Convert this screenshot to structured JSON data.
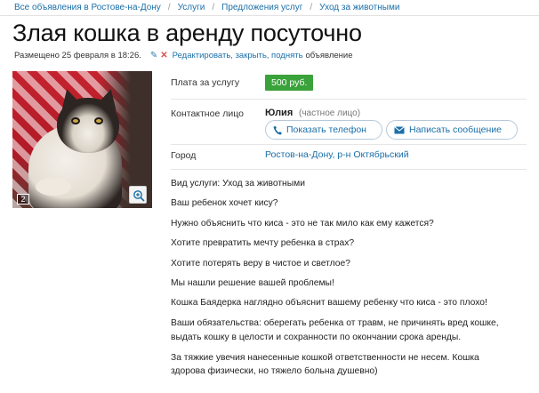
{
  "breadcrumb": {
    "items": [
      "Все объявления в Ростове-на-Дону",
      "Услуги",
      "Предложения услуг",
      "Уход за животными"
    ],
    "separator": "/"
  },
  "title": "Злая кошка в аренду посуточно",
  "meta": {
    "posted": "Размещено 25 февраля в 18:26.",
    "edit_links": "Редактировать, закрыть, поднять",
    "edit_suffix": "объявление"
  },
  "photo": {
    "count": "2",
    "zoom_icon": "magnifier-plus-icon"
  },
  "details": {
    "fee_label": "Плата за услугу",
    "fee_value": "500 руб.",
    "contact_label": "Контактное лицо",
    "contact_name": "Юлия",
    "contact_type": "(частное лицо)",
    "show_phone": "Показать телефон",
    "write_message": "Написать сообщение",
    "city_label": "Город",
    "city_value": "Ростов-на-Дону, р-н Октябрьский"
  },
  "description": [
    "Вид услуги: Уход за животными",
    "Ваш ребенок хочет кису?",
    "Нужно объяснить что киса - это не так мило как ему кажется?",
    "Хотите превратить мечту ребенка в страх?",
    "Хотите потерять веру в чистое и светлое?",
    "Мы нашли решение вашей проблемы!",
    "Кошка Баядерка наглядно объяснит вашему ребенку что киса - это плохо!",
    "Ваши обязательства: оберегать ребенка от травм, не причинять вред кошке,",
    "выдать кошку в целости и сохранности по окончании срока аренды.",
    "За тяжкие увечия нанесенные кошкой ответственности не несем. Кошка",
    "здорова физически, но тяжело больна душевно)"
  ],
  "colors": {
    "link": "#1a6fa8",
    "price_badge": "#3aa23a",
    "delete": "#d9534f"
  }
}
